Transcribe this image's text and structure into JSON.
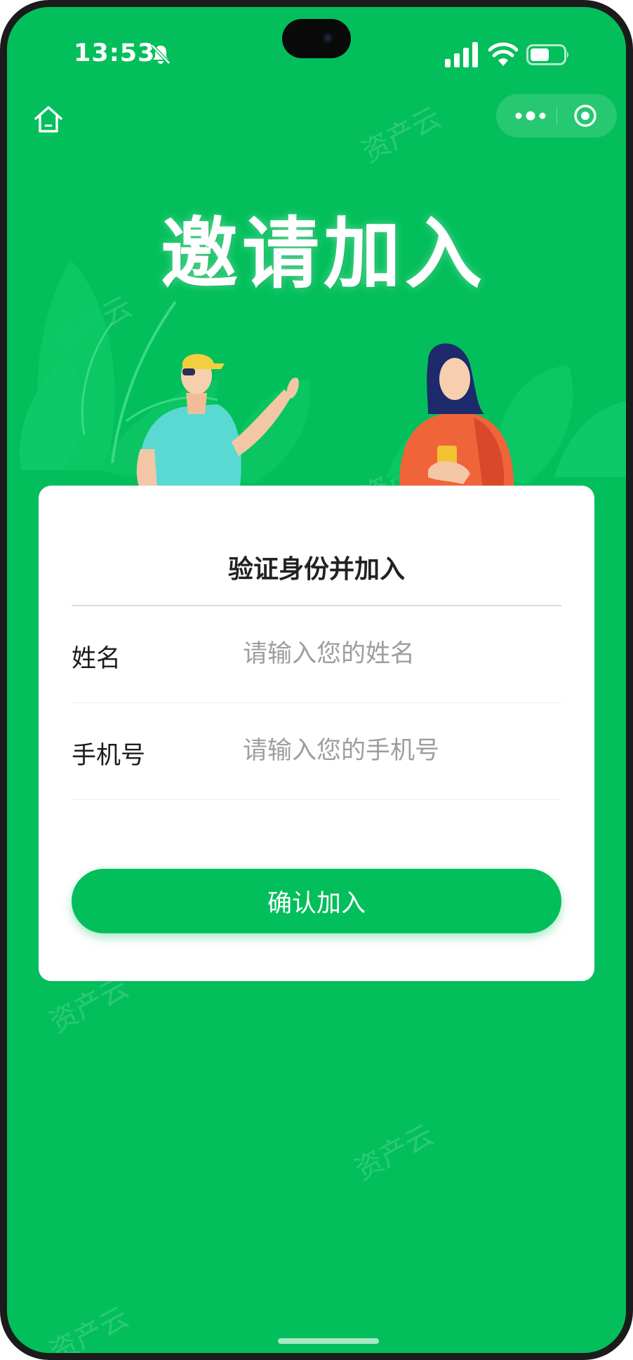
{
  "status_bar": {
    "time": "13:53"
  },
  "banner": {
    "title": "邀请加入"
  },
  "form": {
    "title": "验证身份并加入",
    "fields": [
      {
        "label": "姓名",
        "placeholder": "请输入您的姓名",
        "value": ""
      },
      {
        "label": "手机号",
        "placeholder": "请输入您的手机号",
        "value": ""
      }
    ],
    "submit_label": "确认加入"
  },
  "watermark": {
    "text": "资产云"
  },
  "icons": {
    "status": [
      "bell-slash-icon",
      "cellular-signal-icon",
      "wifi-icon",
      "battery-icon"
    ],
    "nav": [
      "home-icon",
      "more-dots-icon",
      "close-target-icon"
    ]
  },
  "colors": {
    "brand_green": "#03bf5b",
    "card": "#ffffff",
    "placeholder": "#9e9e9e",
    "text": "#222222"
  }
}
